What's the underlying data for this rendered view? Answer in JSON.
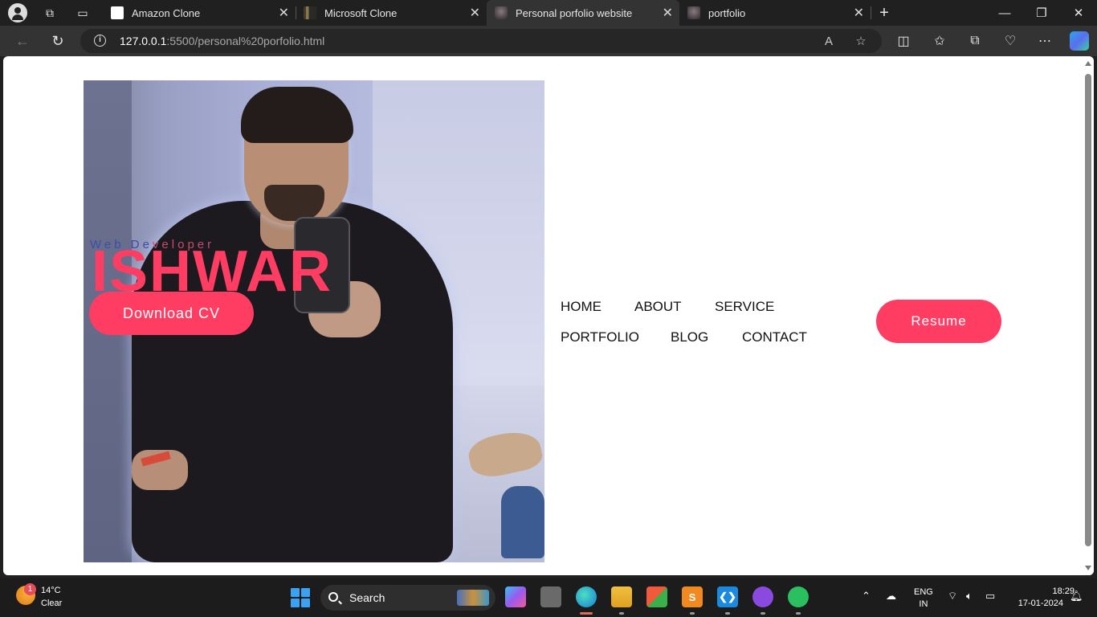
{
  "browser": {
    "tabs": [
      {
        "title": "Amazon Clone",
        "favicon_color": "#ffffff",
        "active": false
      },
      {
        "title": "Microsoft Clone",
        "favicon_color": "#7a6a4a",
        "active": false
      },
      {
        "title": "Personal porfolio website",
        "favicon_color": "#555555",
        "active": true
      },
      {
        "title": "portfolio",
        "favicon_color": "#555555",
        "active": false
      }
    ],
    "new_tab_icon": "+",
    "url_host": "127.0.0.1",
    "url_path": ":5500/personal%20porfolio.html"
  },
  "page": {
    "hero": {
      "subtitle_prefix": "Web De",
      "subtitle_suffix": "veloper",
      "name": "ISHWAR",
      "download_label": "Download CV"
    },
    "nav": {
      "items": [
        "HOME",
        "ABOUT",
        "SERVICE",
        "PORTFOLIO",
        "BLOG",
        "CONTACT"
      ]
    },
    "resume_label": "Resume",
    "accent_color": "#ff3d63"
  },
  "taskbar": {
    "weather": {
      "temp": "14°C",
      "desc": "Clear",
      "badge": "1"
    },
    "search_label": "Search",
    "lang_line1": "ENG",
    "lang_line2": "IN",
    "time": "18:29",
    "date": "17-01-2024"
  }
}
